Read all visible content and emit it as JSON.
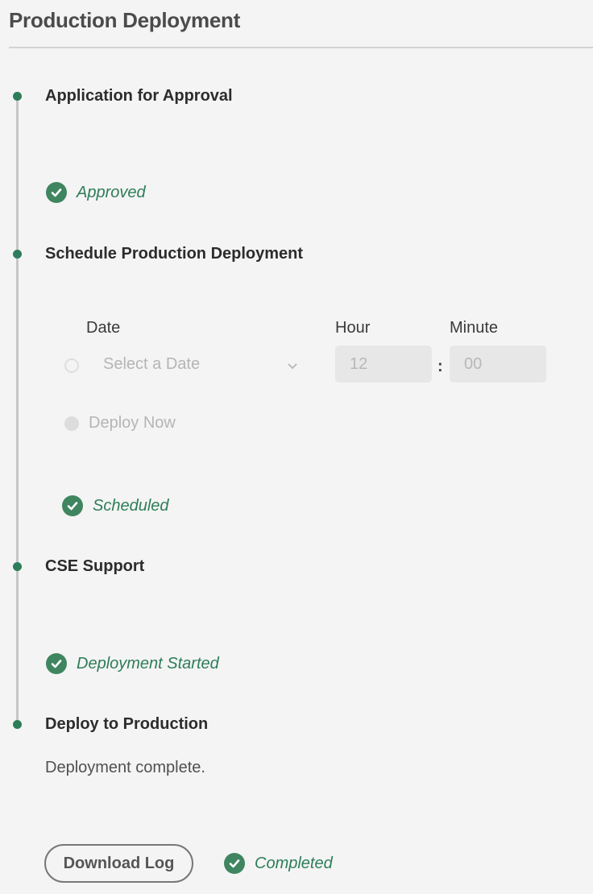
{
  "page": {
    "title": "Production Deployment"
  },
  "steps": [
    {
      "title": "Application for Approval",
      "status": "Approved"
    },
    {
      "title": "Schedule Production Deployment",
      "status": "Scheduled"
    },
    {
      "title": "CSE Support",
      "status": "Deployment Started"
    },
    {
      "title": "Deploy to Production",
      "message": "Deployment complete.",
      "status": "Completed"
    }
  ],
  "schedule": {
    "date_label": "Date",
    "date_placeholder": "Select a Date",
    "hour_label": "Hour",
    "hour_value": "12",
    "minute_label": "Minute",
    "minute_value": "00",
    "separator": ":",
    "deploy_now_label": "Deploy Now"
  },
  "actions": {
    "download_log_label": "Download Log"
  },
  "colors": {
    "accent": "#2d7d5a",
    "check_fill": "#3f8560",
    "timeline": "#c6c6c6"
  },
  "icons": {
    "status": "check-circle-icon",
    "dropdown": "chevron-down-icon"
  }
}
